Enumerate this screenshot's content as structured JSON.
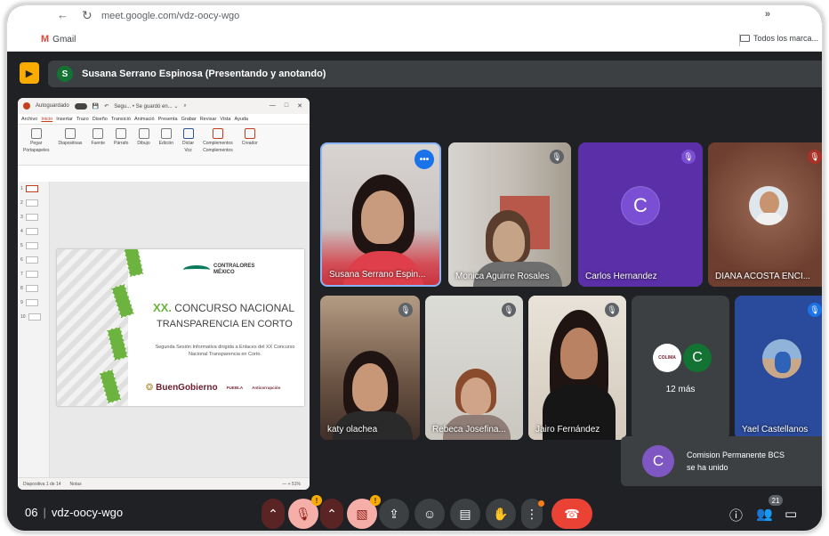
{
  "browser": {
    "url": "meet.google.com/vdz-oocy-wgo",
    "bookmark_gmail": "Gmail",
    "bookmark_all": "Todos los marca..."
  },
  "meet": {
    "presenter_initial": "S",
    "presenter_label": "Susana Serrano Espinosa (Presentando y anotando)",
    "meeting_code": "vdz-oocy-wgo",
    "time_fragment": "06",
    "participant_count": "21",
    "more_label": "12 más"
  },
  "ppt": {
    "autosave": "Autoguardado",
    "file_title": "Segu... • Se guardó en... ⌄",
    "menu": [
      "Archivo",
      "Inicio",
      "Insertar",
      "Trazo",
      "Diseño",
      "Transició",
      "Animació",
      "Presenta",
      "Grabar",
      "Revisar",
      "Vista",
      "Ayuda"
    ],
    "ribbon": [
      "Pegar",
      "Diapositivas",
      "Fuente",
      "Párrafo",
      "Dibujo",
      "Edición",
      "Dictar",
      "Complementos",
      "Creador"
    ],
    "ribbon_groups": [
      "Portapapeles",
      "Voz",
      "Complementos"
    ],
    "thumb_numbers": [
      "1",
      "2",
      "3",
      "4",
      "5",
      "6",
      "7",
      "8",
      "9",
      "10"
    ],
    "status_left": "Diapositiva 1 de 14",
    "status_notes": "Notas",
    "status_zoom": "— + 51%"
  },
  "slide": {
    "logo_text_1": "CONTRALORES",
    "logo_text_2": "MÉXICO",
    "title_num": "XX.",
    "title_rest": " CONCURSO NACIONAL",
    "title_line2": "TRANSPARENCIA EN CORTO",
    "subtitle": "Segunda Sesión Informativa dirigida a Enlaces del XX Concurso Nacional Transparencia en Corto.",
    "footer_brand_1": "Buen",
    "footer_brand_2": "Gobierno",
    "footer_small_1": "PUEBLA",
    "footer_small_2": "Anticorrupción"
  },
  "tiles": [
    {
      "name": "Susana Serrano Espin..."
    },
    {
      "name": "Monica Aguirre Rosales"
    },
    {
      "name": "Carlos Hernandez",
      "initial": "C"
    },
    {
      "name": "DIANA ACOSTA ENCI..."
    },
    {
      "name": "katy olachea"
    },
    {
      "name": "Rebeca Josefina..."
    },
    {
      "name": "Jairo Fernández"
    },
    {
      "name": "Yael Castellanos"
    }
  ],
  "more_tile": {
    "initial": "C",
    "logo_text": "COLIMA"
  },
  "toast": {
    "initial": "C",
    "line1": "Comision Permanente BCS",
    "line2": "se ha unido"
  },
  "colors": {
    "meet_bg": "#202124",
    "tile_bg": "#3c4043",
    "accent_blue": "#1a73e8",
    "end_call": "#ea4335",
    "purple_avatar": "#7e57c2",
    "present_badge": "#f9ab00"
  },
  "controls": [
    "chevron-up-icon",
    "mic-off-icon",
    "chevron-up-icon",
    "camera-off-icon",
    "present-icon",
    "emoji-icon",
    "captions-icon",
    "raise-hand-icon",
    "more-icon",
    "end-call-icon"
  ],
  "right_controls": [
    "info-icon",
    "people-icon",
    "chat-icon"
  ]
}
